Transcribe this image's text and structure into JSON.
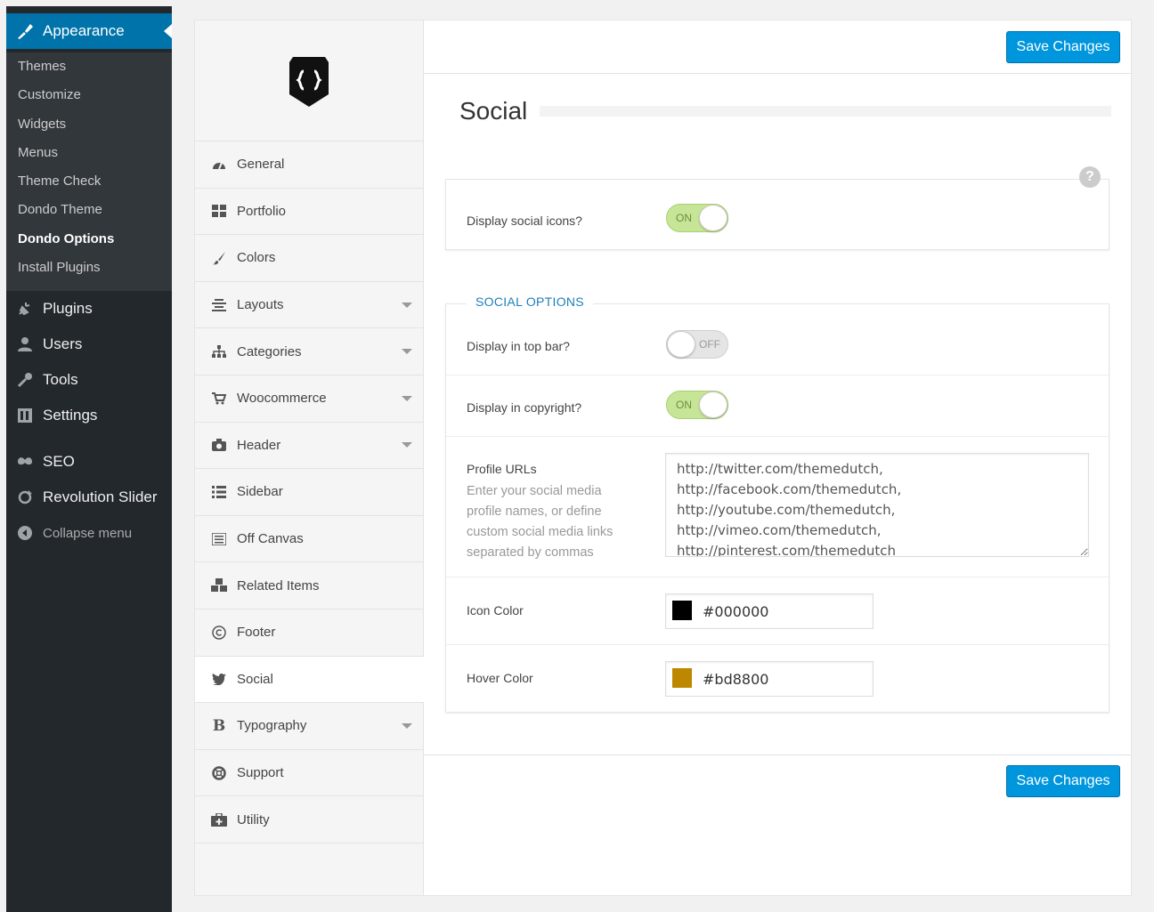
{
  "sidebar": {
    "active_menu": "Appearance",
    "submenu": [
      "Themes",
      "Customize",
      "Widgets",
      "Menus",
      "Theme Check",
      "Dondo Theme",
      "Dondo Options",
      "Install Plugins"
    ],
    "current_submenu": "Dondo Options",
    "menu": [
      {
        "label": "Plugins",
        "icon": "plugins-icon"
      },
      {
        "label": "Users",
        "icon": "users-icon"
      },
      {
        "label": "Tools",
        "icon": "tools-icon"
      },
      {
        "label": "Settings",
        "icon": "settings-icon"
      },
      {
        "label": "SEO",
        "icon": "seo-icon"
      },
      {
        "label": "Revolution Slider",
        "icon": "refresh-icon"
      },
      {
        "label": "Collapse menu",
        "icon": "collapse-icon"
      }
    ]
  },
  "options_nav": [
    {
      "label": "General",
      "icon": "dashboard-icon",
      "has_caret": false
    },
    {
      "label": "Portfolio",
      "icon": "grid-icon",
      "has_caret": false
    },
    {
      "label": "Colors",
      "icon": "brush-icon",
      "has_caret": false
    },
    {
      "label": "Layouts",
      "icon": "align-icon",
      "has_caret": true
    },
    {
      "label": "Categories",
      "icon": "sitemap-icon",
      "has_caret": true
    },
    {
      "label": "Woocommerce",
      "icon": "cart-icon",
      "has_caret": true
    },
    {
      "label": "Header",
      "icon": "camera-icon",
      "has_caret": true
    },
    {
      "label": "Sidebar",
      "icon": "list-icon",
      "has_caret": false
    },
    {
      "label": "Off Canvas",
      "icon": "lines-icon",
      "has_caret": false
    },
    {
      "label": "Related Items",
      "icon": "cubes-icon",
      "has_caret": false
    },
    {
      "label": "Footer",
      "icon": "copyright-icon",
      "has_caret": false
    },
    {
      "label": "Social",
      "icon": "twitter-icon",
      "has_caret": false,
      "active": true
    },
    {
      "label": "Typography",
      "icon": "bold-icon",
      "has_caret": true
    },
    {
      "label": "Support",
      "icon": "lifebuoy-icon",
      "has_caret": false
    },
    {
      "label": "Utility",
      "icon": "medkit-icon",
      "has_caret": false
    }
  ],
  "main": {
    "save_label": "Save Changes",
    "section_title": "Social",
    "help_glyph": "?",
    "display_social_icons": {
      "label": "Display social icons?",
      "state": "ON"
    },
    "social_options_title": "SOCIAL OPTIONS",
    "top_bar": {
      "label": "Display in top bar?",
      "state": "OFF"
    },
    "copyright": {
      "label": "Display in copyright?",
      "state": "ON"
    },
    "profile_urls": {
      "label": "Profile URLs",
      "description": "Enter your social media profile names, or define custom social media links separated by commas",
      "value": "http://twitter.com/themedutch,\nhttp://facebook.com/themedutch,\nhttp://youtube.com/themedutch,\nhttp://vimeo.com/themedutch,\nhttp://pinterest.com/themedutch"
    },
    "icon_color": {
      "label": "Icon Color",
      "value": "#000000"
    },
    "hover_color": {
      "label": "Hover Color",
      "value": "#bd8800"
    }
  },
  "colors": {
    "accent": "#0073aa",
    "button": "#0096dd",
    "sidebar_bg": "#23282d",
    "toggle_on": "#c6e596",
    "legend": "#1e7eb8"
  }
}
